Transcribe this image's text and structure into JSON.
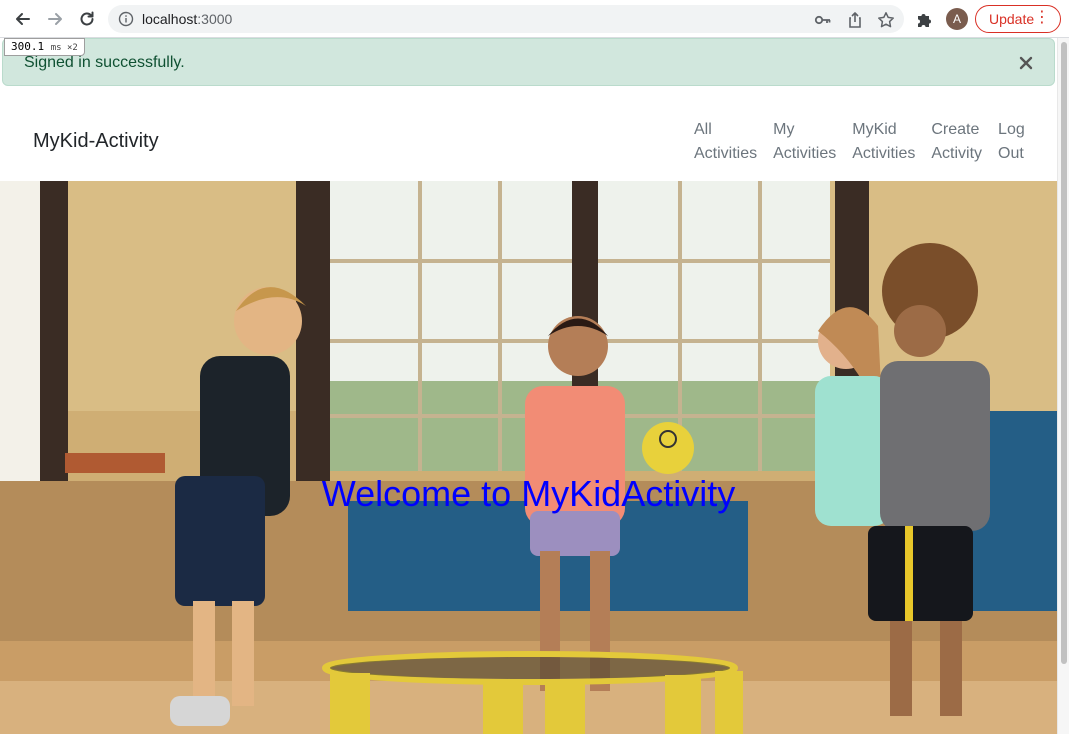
{
  "browser": {
    "url_host": "localhost",
    "url_port": ":3000",
    "avatar_letter": "A",
    "update_label": "Update",
    "perf_value": "300.1",
    "perf_unit": "ms ×2"
  },
  "alert": {
    "message": "Signed in successfully."
  },
  "navbar": {
    "brand": "MyKid-Activity",
    "links": [
      {
        "line1": "All",
        "line2": "Activities"
      },
      {
        "line1": "My",
        "line2": "Activities"
      },
      {
        "line1": "MyKid",
        "line2": "Activities"
      },
      {
        "line1": "Create",
        "line2": "Activity"
      },
      {
        "line1": "Log",
        "line2": "Out"
      }
    ]
  },
  "hero": {
    "title": "Welcome to MyKidActivity",
    "title_color": "#0000ff"
  },
  "colors": {
    "alert_bg": "#d1e7dd",
    "alert_text": "#0f5132",
    "update_red": "#d93025"
  }
}
